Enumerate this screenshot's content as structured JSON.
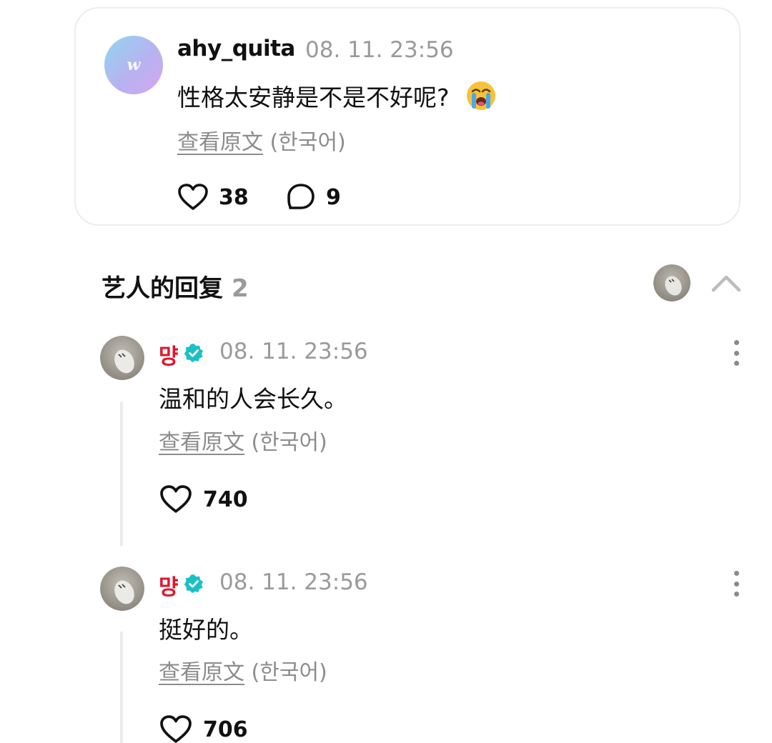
{
  "post": {
    "author": "ahy_quita",
    "time": "08. 11. 23:56",
    "text": "性格太安静是不是不好呢?",
    "emoji": "loudly-crying-face",
    "translate_link": "查看原文",
    "translate_lang": "(한국어)",
    "likes": "38",
    "comments": "9"
  },
  "artist_replies": {
    "title": "艺人的回复",
    "count": "2",
    "items": [
      {
        "name": "먕",
        "time": "08. 11. 23:56",
        "text": "温和的人会长久。",
        "translate_link": "查看原文",
        "translate_lang": "(한국어)",
        "likes": "740"
      },
      {
        "name": "먕",
        "time": "08. 11. 23:56",
        "text": "挺好的。",
        "translate_link": "查看原文",
        "translate_lang": "(한국어)",
        "likes": "706"
      }
    ]
  },
  "colors": {
    "artist_name": "#e0142c",
    "verified_badge": "#1bbfc9",
    "muted_text": "#9a9a9a",
    "card_border": "#ececef"
  },
  "icons": [
    "heart-icon",
    "comment-bubble-icon",
    "more-options-icon",
    "verified-badge-icon",
    "chevron-up-icon"
  ]
}
